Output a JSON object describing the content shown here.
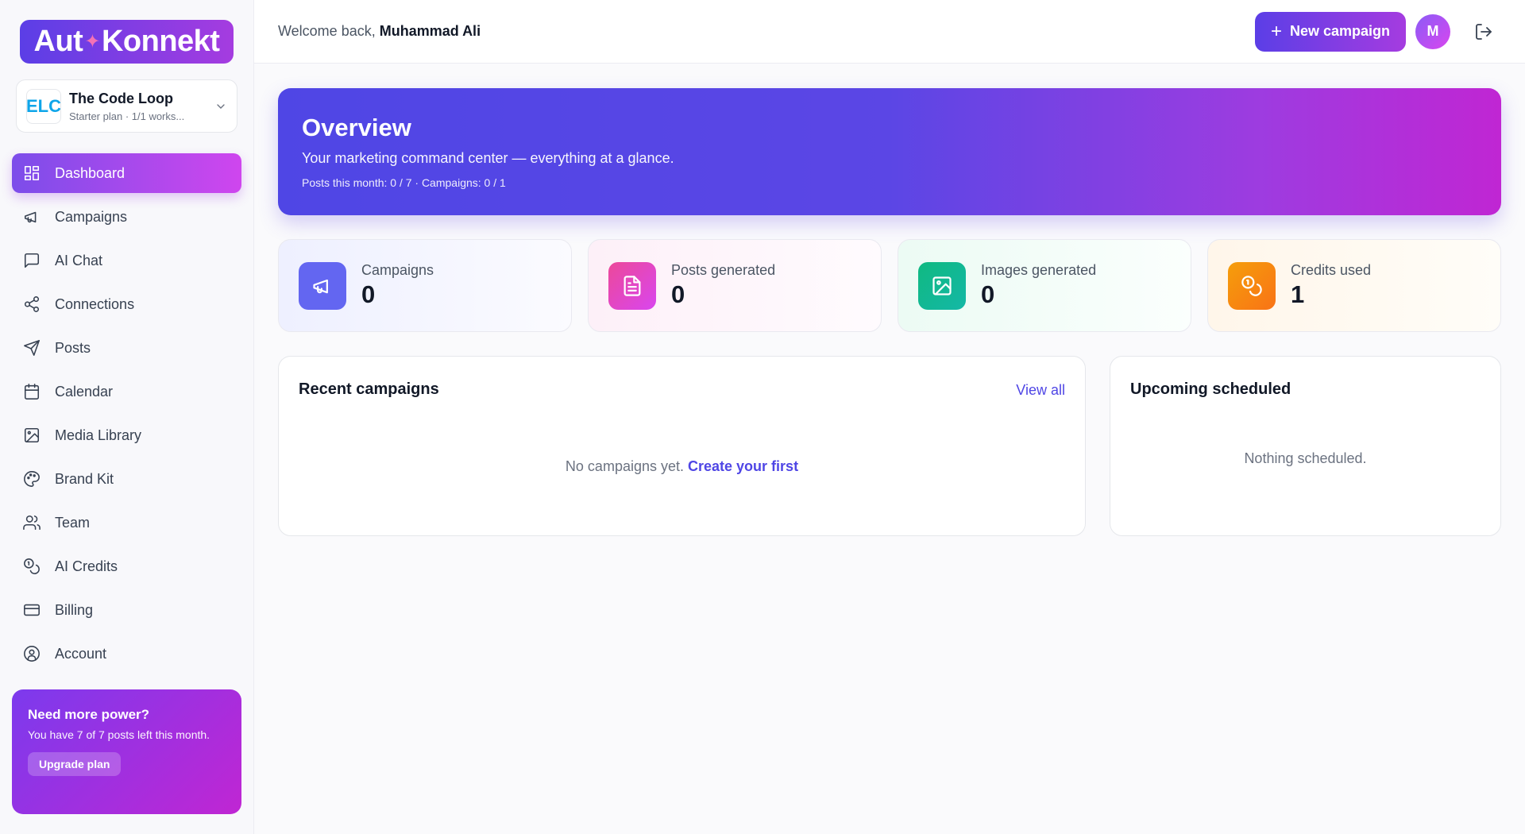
{
  "brand": {
    "logo_left": "Aut",
    "logo_right": "Konnekt"
  },
  "workspace": {
    "logo_text": "ELC",
    "name": "The Code Loop",
    "plan": "Starter plan · 1/1 works..."
  },
  "nav": [
    {
      "label": "Dashboard",
      "icon": "grid-icon",
      "active": true
    },
    {
      "label": "Campaigns",
      "icon": "megaphone-icon"
    },
    {
      "label": "AI Chat",
      "icon": "chat-icon"
    },
    {
      "label": "Connections",
      "icon": "share-icon"
    },
    {
      "label": "Posts",
      "icon": "send-icon"
    },
    {
      "label": "Calendar",
      "icon": "calendar-icon"
    },
    {
      "label": "Media Library",
      "icon": "image-icon"
    },
    {
      "label": "Brand Kit",
      "icon": "palette-icon"
    },
    {
      "label": "Team",
      "icon": "users-icon"
    },
    {
      "label": "AI Credits",
      "icon": "coins-icon"
    },
    {
      "label": "Billing",
      "icon": "card-icon"
    },
    {
      "label": "Account",
      "icon": "user-circle-icon"
    }
  ],
  "upgrade": {
    "title": "Need more power?",
    "text": "You have 7 of 7 posts left this month.",
    "button": "Upgrade plan"
  },
  "topbar": {
    "welcome_prefix": "Welcome back, ",
    "user_name": "Muhammad Ali",
    "new_campaign": "New campaign",
    "avatar_initial": "M"
  },
  "hero": {
    "title": "Overview",
    "subtitle": "Your marketing command center — everything at a glance.",
    "meta": "Posts this month: 0 / 7 · Campaigns: 0 / 1"
  },
  "stats": [
    {
      "label": "Campaigns",
      "value": "0",
      "color": "#6366f1"
    },
    {
      "label": "Posts generated",
      "value": "0",
      "color": "#ec4899"
    },
    {
      "label": "Images generated",
      "value": "0",
      "color": "#10b981"
    },
    {
      "label": "Credits used",
      "value": "1",
      "color": "#f97316"
    }
  ],
  "recent": {
    "title": "Recent campaigns",
    "view_all": "View all",
    "empty_text": "No campaigns yet.",
    "empty_link": "Create your first"
  },
  "upcoming": {
    "title": "Upcoming scheduled",
    "empty_text": "Nothing scheduled."
  }
}
